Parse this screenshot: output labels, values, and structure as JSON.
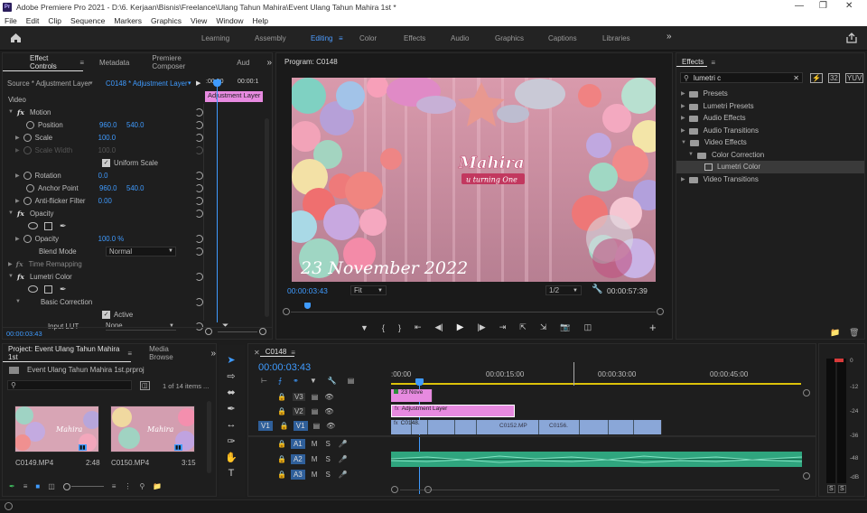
{
  "app": {
    "title": "Adobe Premiere Pro 2021 - D:\\6. Kerjaan\\Bisnis\\Freelance\\Ulang Tahun Mahira\\Event Ulang Tahun Mahira 1st *",
    "logo": "Pr"
  },
  "menu": [
    "File",
    "Edit",
    "Clip",
    "Sequence",
    "Markers",
    "Graphics",
    "View",
    "Window",
    "Help"
  ],
  "workspaces": [
    "Learning",
    "Assembly",
    "Editing",
    "Color",
    "Effects",
    "Audio",
    "Graphics",
    "Captions",
    "Libraries"
  ],
  "active_workspace": "Editing",
  "effect_controls": {
    "tabs": [
      "Effect Controls",
      "Metadata",
      "Premiere Composer",
      "Aud"
    ],
    "source": "Source * Adjustment Layer",
    "target": "C0148 * Adjustment Layer",
    "ruler_start": ":00:00",
    "ruler_end": "00:00:1",
    "clip_label": "Adjustment Layer",
    "section": "Video",
    "motion": "Motion",
    "position_label": "Position",
    "position_x": "960.0",
    "position_y": "540.0",
    "scale_label": "Scale",
    "scale_val": "100.0",
    "scale_width_label": "Scale Width",
    "scale_width_val": "100.0",
    "uniform_label": "Uniform Scale",
    "rotation_label": "Rotation",
    "rotation_val": "0.0",
    "anchor_label": "Anchor Point",
    "anchor_x": "960.0",
    "anchor_y": "540.0",
    "flicker_label": "Anti-flicker Filter",
    "flicker_val": "0.00",
    "opacity": "Opacity",
    "opacity_label": "Opacity",
    "opacity_val": "100.0 %",
    "blend_label": "Blend Mode",
    "blend_val": "Normal",
    "time_remap": "Time Remapping",
    "lumetri": "Lumetri Color",
    "basic": "Basic Correction",
    "active_label": "Active",
    "lut_label": "Input LUT",
    "lut_val": "None",
    "timecode": "00:00:03:43"
  },
  "program": {
    "title": "Program: C0148",
    "overlay_text": "23 November 2022",
    "sign_title": "Mahira",
    "sign_sub": "u turning One",
    "timecode": "00:00:03:43",
    "fit": "Fit",
    "quality": "1/2",
    "duration": "00:00:57:39"
  },
  "effects": {
    "title": "Effects",
    "search": "lumetri c",
    "items": [
      {
        "label": "Presets"
      },
      {
        "label": "Lumetri Presets"
      },
      {
        "label": "Audio Effects"
      },
      {
        "label": "Audio Transitions"
      },
      {
        "label": "Video Effects"
      },
      {
        "label": "Color Correction"
      },
      {
        "label": "Lumetri Color"
      },
      {
        "label": "Video Transitions"
      }
    ]
  },
  "project": {
    "tabs": [
      "Project: Event Ulang Tahun Mahira 1st",
      "Media Browse"
    ],
    "file": "Event Ulang Tahun Mahira 1st.prproj",
    "count": "1 of 14 items ...",
    "clips": [
      {
        "name": "C0149.MP4",
        "dur": "2:48"
      },
      {
        "name": "C0150.MP4",
        "dur": "3:15"
      }
    ]
  },
  "timeline": {
    "tab": "C0148",
    "timecode": "00:00:03:43",
    "ruler": [
      ":00:00",
      "00:00:15:00",
      "00:00:30:00",
      "00:00:45:00"
    ],
    "video_tracks": [
      "V3",
      "V2",
      "V1"
    ],
    "audio_tracks": [
      "A1",
      "A2",
      "A3"
    ],
    "src_v": "V1",
    "src_a": "A1",
    "clips": {
      "v3": "23 Nove",
      "v2": "Adjustment Layer",
      "v1a": "C0148.",
      "v1b": "C0152.MP",
      "v1c": "C0156."
    }
  },
  "meter": {
    "labels": [
      "0",
      "-12",
      "-24",
      "-36",
      "-48",
      "-dB"
    ],
    "solo": [
      "S",
      "S"
    ]
  },
  "colors": {
    "accent": "#3f9bff",
    "adjustment": "#e78ae0",
    "video_clip": "#8aa7d8",
    "audio_clip": "#2fa57e",
    "title_clip": "#e78ae0"
  }
}
